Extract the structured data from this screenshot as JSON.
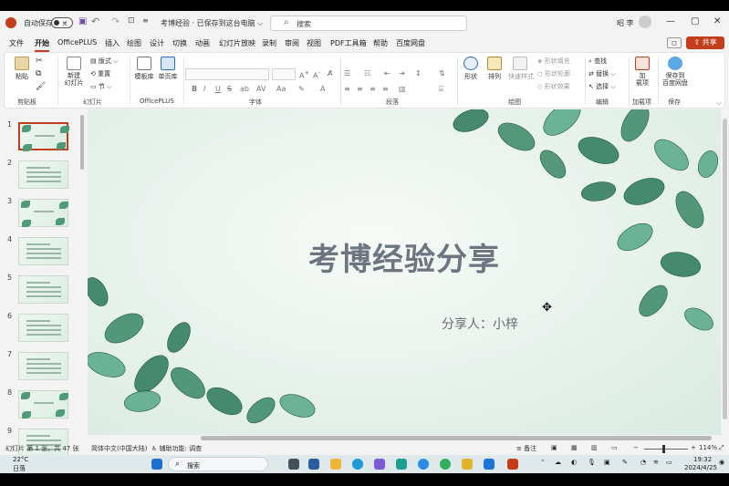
{
  "titlebar": {
    "autosave_label": "自动保存",
    "autosave_state": "关",
    "doc_title": "考博经验 · 已保存到这台电脑 ⌵",
    "search_placeholder": "搜索",
    "user_name": "昭 李",
    "minimize": "—",
    "maximize": "▢",
    "close": "✕"
  },
  "menu": [
    "文件",
    "开始",
    "OfficePLUS",
    "插入",
    "绘图",
    "设计",
    "切换",
    "动画",
    "幻灯片放映",
    "录制",
    "审阅",
    "视图",
    "PDF工具箱",
    "帮助",
    "百度网盘"
  ],
  "menu_active_index": 1,
  "share_label": "共享",
  "ribbon": {
    "clipboard": {
      "paste": "粘贴",
      "label": "剪贴板"
    },
    "slides": {
      "new_slide": "新建\n幻灯片",
      "layout": "版式",
      "reset": "重置",
      "section": "节",
      "label": "幻灯片"
    },
    "officeplus": {
      "template": "模板库",
      "single_page": "单页库",
      "label": "OfficePLUS"
    },
    "font": {
      "label": "字体",
      "bold": "B",
      "italic": "I",
      "underline": "U",
      "strike": "S"
    },
    "paragraph": {
      "label": "段落"
    },
    "drawing": {
      "shape": "形状",
      "arrange": "排列",
      "quick_style": "快速样式",
      "fill": "形状填充",
      "outline": "形状轮廓",
      "effect": "形状效果",
      "label": "绘图"
    },
    "editing": {
      "find": "查找",
      "replace": "替换",
      "select": "选择",
      "label": "编辑"
    },
    "addins": {
      "addin": "加\n载项",
      "label": "加载项"
    },
    "save": {
      "baidu": "保存到\n百度网盘",
      "label": "保存"
    }
  },
  "thumbnails": [
    {
      "num": "1",
      "selected": true
    },
    {
      "num": "2",
      "selected": false
    },
    {
      "num": "3",
      "selected": false
    },
    {
      "num": "4",
      "selected": false
    },
    {
      "num": "5",
      "selected": false
    },
    {
      "num": "6",
      "selected": false
    },
    {
      "num": "7",
      "selected": false
    },
    {
      "num": "8",
      "selected": false
    },
    {
      "num": "9",
      "selected": false
    }
  ],
  "slide": {
    "title": "考博经验分享",
    "subtitle": "分享人：小梓"
  },
  "statusbar": {
    "slide_count": "幻灯片 第 1 张，共 47 张",
    "language": "简体中文(中国大陆)",
    "accessibility": "辅助功能: 调查",
    "notes": "备注",
    "zoom": "114%"
  },
  "taskbar": {
    "weather_temp": "22°C",
    "weather_desc": "日落",
    "search_label": "搜索",
    "time": "19:32",
    "date": "2024/4/25"
  },
  "colors": {
    "accent": "#c43e1c",
    "slide_title": "#6c7580",
    "leaf": "#3f8a6b"
  }
}
